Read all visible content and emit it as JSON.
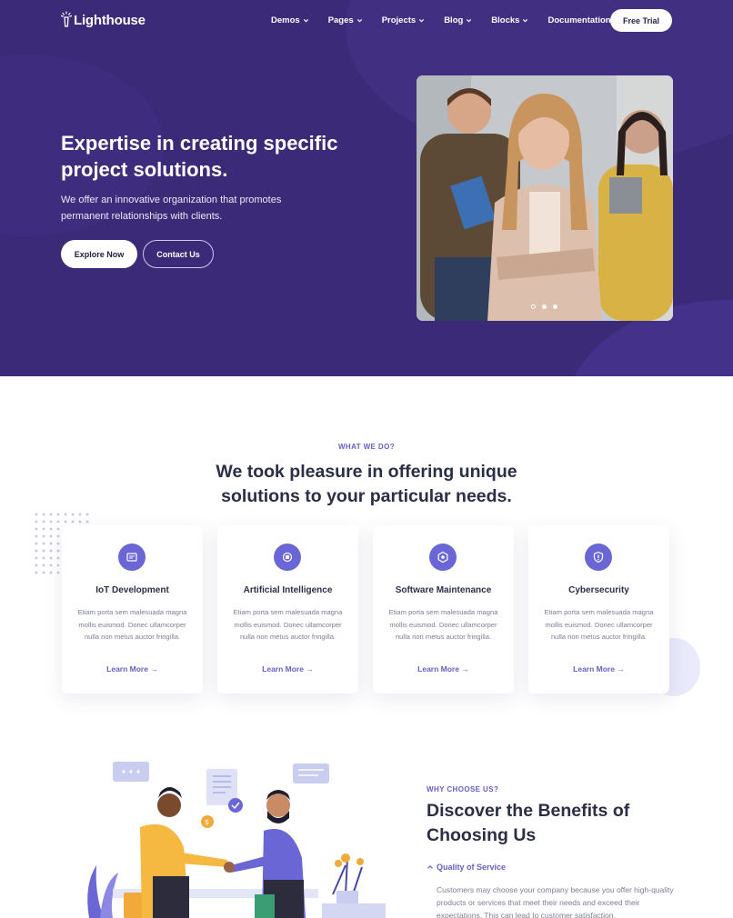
{
  "nav": {
    "logo_text": "Lighthouse",
    "items": [
      {
        "label": "Demos"
      },
      {
        "label": "Pages"
      },
      {
        "label": "Projects"
      },
      {
        "label": "Blog"
      },
      {
        "label": "Blocks"
      },
      {
        "label": "Documentation"
      }
    ],
    "cta_label": "Free Trial"
  },
  "hero": {
    "title": "Expertise in creating specific project solutions.",
    "subtitle": "We offer an innovative organization that promotes permanent relationships with clients.",
    "primary_button": "Explore Now",
    "secondary_button": "Contact Us",
    "slider": {
      "count": 3,
      "active": 0
    }
  },
  "services": {
    "eyebrow": "WHAT WE DO?",
    "title": "We took pleasure in offering unique solutions to your particular needs.",
    "cards": [
      {
        "icon": "iot-icon",
        "title": "IoT Development",
        "text": "Etiam porta sem malesuada magna mollis euismod. Donec ullamcorper nulla non metus auctor fringilla.",
        "link": "Learn More →"
      },
      {
        "icon": "ai-chip-icon",
        "title": "Artificial Intelligence",
        "text": "Etiam porta sem malesuada magna mollis euismod. Donec ullamcorper nulla non metus auctor fringilla.",
        "link": "Learn More →"
      },
      {
        "icon": "settings-gear-icon",
        "title": "Software Maintenance",
        "text": "Etiam porta sem malesuada magna mollis euismod. Donec ullamcorper nulla non metus auctor fringilla.",
        "link": "Learn More →"
      },
      {
        "icon": "shield-icon",
        "title": "Cybersecurity",
        "text": "Etiam porta sem malesuada magna mollis euismod. Donec ullamcorper nulla non metus auctor fringilla.",
        "link": "Learn More →"
      }
    ]
  },
  "benefits": {
    "eyebrow": "WHY CHOOSE US?",
    "title": "Discover the Benefits of Choosing Us",
    "accordion": {
      "title": "Quality of Service",
      "body": "Customers may choose your company because you offer high-quality products or services that meet their needs and exceed their expectations. This can lead to customer satisfaction."
    }
  },
  "colors": {
    "hero_bg": "#3b2a78",
    "accent": "#6461c4",
    "icon_bg": "#6b66d6"
  }
}
